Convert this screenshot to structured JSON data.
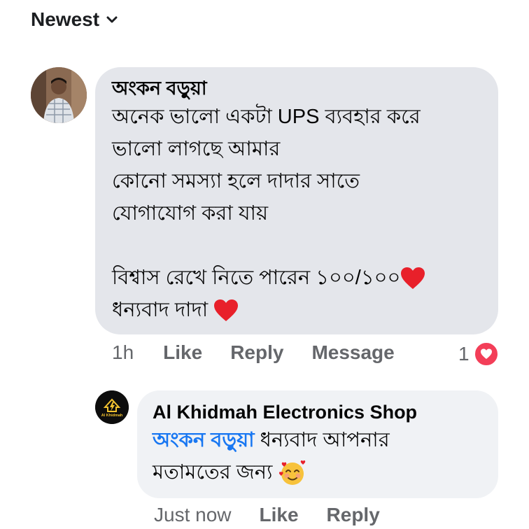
{
  "sort": {
    "label": "Newest",
    "icon": "chevron-down-icon"
  },
  "comment": {
    "author": "অংকন বড়ুয়া",
    "lines": [
      "অনেক ভালো একটা UPS ব্যবহার করে",
      "ভালো লাগছে আমার",
      "কোনো সমস্যা  হলে দাদার সাতে",
      "যোগাযোগ  করা যায়",
      "বিশ্বাস রেখে নিতে পারেন ১০০/১০০",
      "ধন্যবাদ দাদা"
    ],
    "time": "1h",
    "actions": {
      "like": "Like",
      "reply": "Reply",
      "message": "Message"
    },
    "reaction_count": "1",
    "reaction_icon": "heart-icon"
  },
  "reply": {
    "author": "Al Khidmah Electronics Shop",
    "avatar_text": "Al Khidmah",
    "mention": "অংকন বড়ুয়া",
    "line1_rest": " ধন্যবাদ আপনার",
    "line2": "মতামতের জন্য",
    "emoji": "smiling-face-with-hearts-icon",
    "time": "Just now",
    "actions": {
      "like": "Like",
      "reply": "Reply"
    }
  },
  "colors": {
    "accent": "#1877f2",
    "heart": "#f33e58",
    "muted": "#65676b",
    "bubble": "#e4e6eb"
  }
}
